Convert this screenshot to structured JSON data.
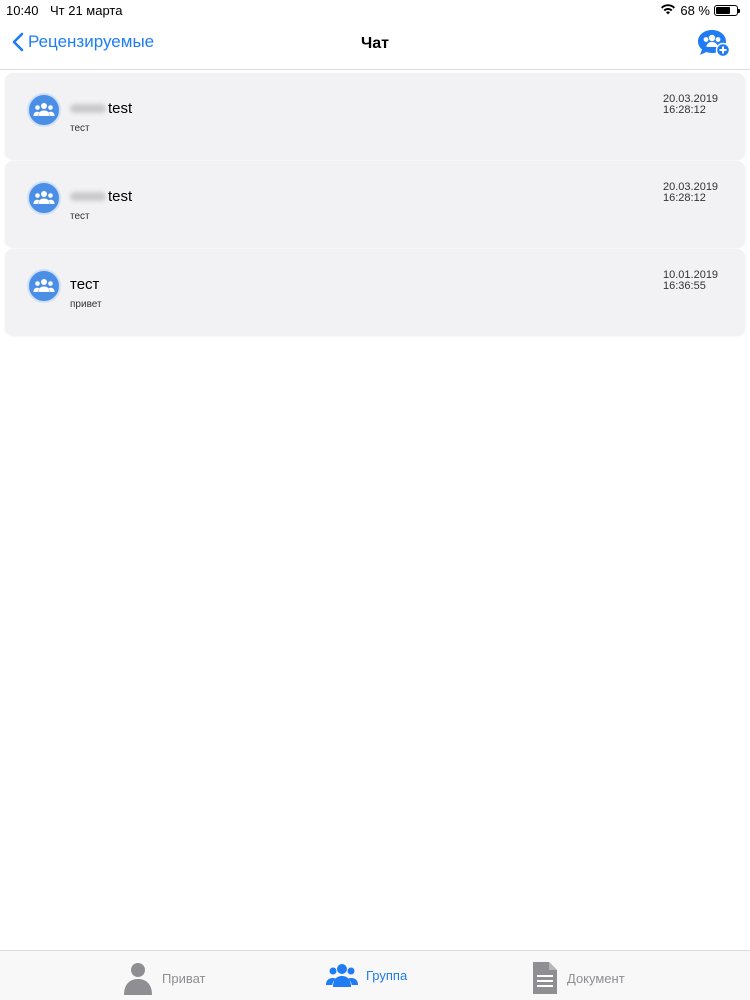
{
  "status": {
    "time": "10:40",
    "date": "Чт 21 марта",
    "battery": "68 %",
    "battery_level": 0.68
  },
  "nav": {
    "back_label": "Рецензируемые",
    "title": "Чат",
    "action_icon": "group-add-icon"
  },
  "chats": [
    {
      "title": "test",
      "subtitle": "тест",
      "date": "20.03.2019",
      "time": "16:28:12",
      "name_redacted": true
    },
    {
      "title": "test",
      "subtitle": "тест",
      "date": "20.03.2019",
      "time": "16:28:12",
      "name_redacted": true
    },
    {
      "title": "тест",
      "subtitle": "привет",
      "date": "10.01.2019",
      "time": "16:36:55",
      "name_redacted": false
    }
  ],
  "tabs": [
    {
      "label": "Приват",
      "icon": "person-icon",
      "active": false
    },
    {
      "label": "Группа",
      "icon": "group-icon",
      "active": true
    },
    {
      "label": "Документ",
      "icon": "document-icon",
      "active": false
    }
  ],
  "colors": {
    "accent": "#1f7cf2",
    "avatar": "#4a8ee6",
    "card_bg": "#f2f2f4",
    "inactive": "#8e8e93"
  }
}
